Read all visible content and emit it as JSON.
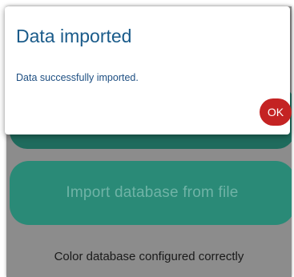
{
  "dialog": {
    "title": "Data imported",
    "message": "Data successfully imported.",
    "ok_label": "OK"
  },
  "main": {
    "import_button_label": "Import database from file",
    "status_text": "Color database configured correctly"
  },
  "colors": {
    "title": "#1a5b8a",
    "message": "#1e4f82",
    "ok_button": "#c42323",
    "primary_button": "#2a8a77",
    "dimmed_overlay": "#8c8c8c"
  }
}
